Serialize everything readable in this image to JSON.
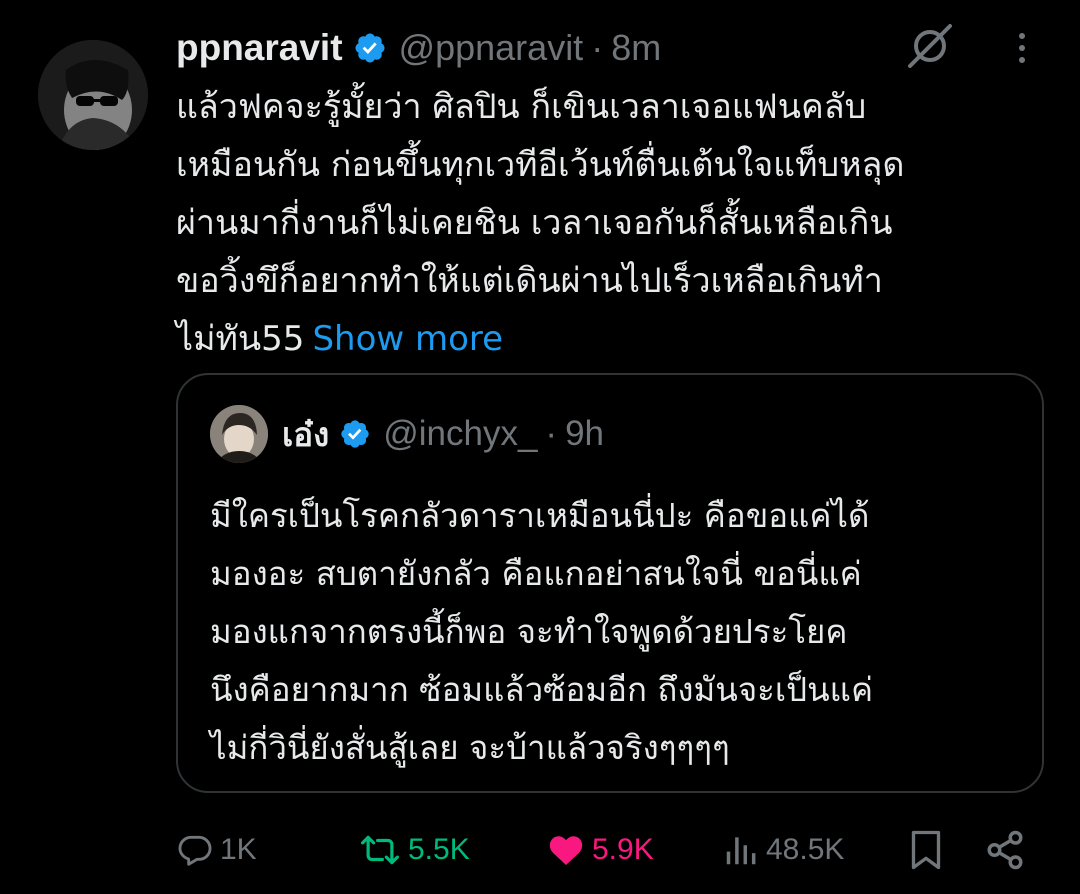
{
  "post": {
    "author": {
      "display_name": "ppnaravit",
      "handle": "@ppnaravit",
      "verified": true,
      "time": "8m"
    },
    "text_lines": [
      "แล้วฟคจะรู้มั้ยว่า ศิลปิน ก็เขินเวลาเจอแฟนคลับ",
      "เหมือนกัน ก่อนขึ้นทุกเวทีอีเว้นท์ตื่นเต้นใจแท็บหลุด",
      "ผ่านมากี่งานก็ไม่เคยชิน เวลาเจอกันก็สั้นเหลือเกิน",
      "ขอวิ้งขึก็อยากทำให้แต่เดินผ่านไปเร็วเหลือเกินทำ",
      "ไม่ทัน55"
    ],
    "show_more_label": "Show more",
    "separator": "·"
  },
  "quote": {
    "author": {
      "display_name": "เอ๋ง",
      "handle": "@inchyx_",
      "verified": true,
      "time": "9h"
    },
    "text_lines": [
      "มีใครเป็นโรคกลัวดาราเหมือนนี่ปะ คือขอแค่ได้",
      "มองอะ สบตายังกลัว คือแกอย่าสนใจนี่ ขอนี่แค่",
      "มองแกจากตรงนี้ก็พอ จะทำใจพูดด้วยประโยค",
      "นึงคือยากมาก ซ้อมแล้วซ้อมอีก ถึงมันจะเป็นแค่",
      "ไม่กี่วินี่ยังสั่นสู้เลย จะบ้าแล้วจริงๆๆๆๆ"
    ]
  },
  "actions": {
    "replies": "1K",
    "reposts": "5.5K",
    "likes": "5.9K",
    "views": "48.5K"
  },
  "colors": {
    "background": "#000000",
    "text": "#e7e9ea",
    "muted": "#71767b",
    "link": "#1d9bf0",
    "verified": "#1d9bf0",
    "repost_active": "#00ba7c",
    "like_active": "#f91880",
    "border": "#2f3336"
  },
  "icons": {
    "verified": "verified-badge-icon",
    "grok": "grok-icon",
    "more": "more-vertical-icon",
    "reply": "reply-icon",
    "repost": "repost-icon",
    "like": "heart-icon",
    "views": "views-icon",
    "bookmark": "bookmark-icon",
    "share": "share-icon"
  }
}
